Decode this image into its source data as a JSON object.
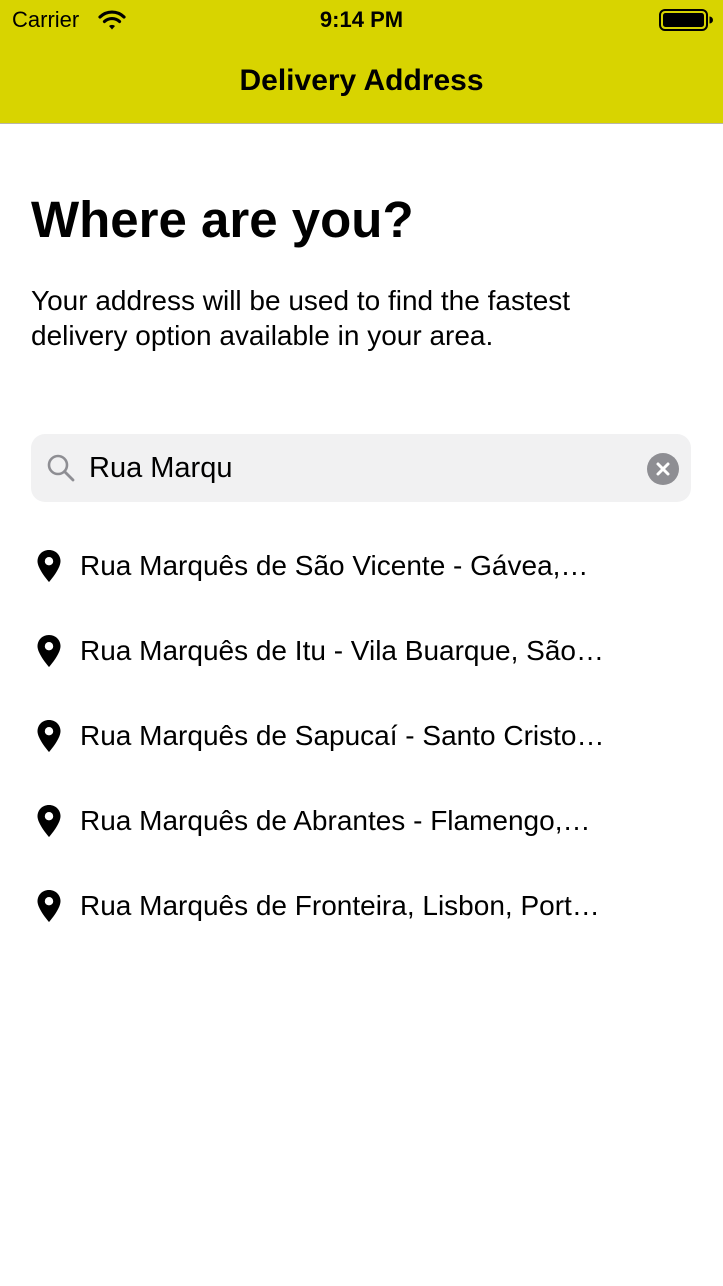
{
  "status_bar": {
    "carrier": "Carrier",
    "time": "9:14 PM",
    "wifi_icon": "wifi-icon",
    "battery_icon": "battery-icon"
  },
  "nav": {
    "title": "Delivery Address",
    "background": "#d8d400"
  },
  "main": {
    "title": "Where are you?",
    "description": "Your address will be used to find the fastest delivery option available in your area."
  },
  "search": {
    "value": "Rua Marqu",
    "search_icon": "search-icon",
    "clear_icon": "clear-icon"
  },
  "results": [
    {
      "label": "Rua Marquês de São Vicente - Gávea,…",
      "icon": "map-pin-icon"
    },
    {
      "label": "Rua Marquês de Itu - Vila Buarque, São…",
      "icon": "map-pin-icon"
    },
    {
      "label": "Rua Marquês de Sapucaí - Santo Cristo…",
      "icon": "map-pin-icon"
    },
    {
      "label": "Rua Marquês de Abrantes - Flamengo,…",
      "icon": "map-pin-icon"
    },
    {
      "label": "Rua Marquês de Fronteira, Lisbon, Port…",
      "icon": "map-pin-icon"
    }
  ]
}
